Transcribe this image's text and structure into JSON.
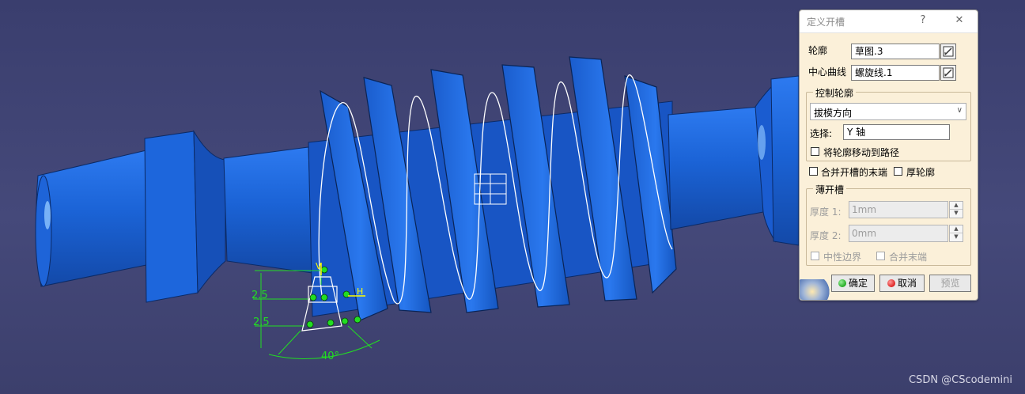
{
  "dialog": {
    "title": "定义开槽",
    "help_symbol": "?",
    "close_symbol": "✕",
    "profile_label": "轮廓",
    "profile_value": "草图.3",
    "center_curve_label": "中心曲线",
    "center_curve_value": "螺旋线.1",
    "control_group": {
      "legend": "控制轮廓",
      "mode_value": "拔模方向",
      "select_label": "选择:",
      "select_value": "Y 轴",
      "move_profile_label": "将轮廓移动到路径"
    },
    "merge_ends_label": "合并开槽的末端",
    "thick_profile_label": "厚轮廓",
    "thin_group": {
      "legend": "薄开槽",
      "thickness1_label": "厚度 1:",
      "thickness1_value": "1mm",
      "thickness2_label": "厚度 2:",
      "thickness2_value": "0mm",
      "neutral_label": "中性边界",
      "merge_label": "合并末端"
    },
    "ok_label": "确定",
    "cancel_label": "取消",
    "preview_label": "预览"
  },
  "sketch": {
    "dim_upper": "2.5",
    "dim_lower": "2.5",
    "angle": "40°",
    "axis_h": "H",
    "axis_v": "V"
  },
  "watermark": "CSDN @CScodemini",
  "colors": {
    "background": "#3f4373",
    "part": "#1b63d6",
    "sketch": "#22dd22",
    "ok_dot": "#22aa22",
    "cancel_dot": "#dd2222"
  }
}
